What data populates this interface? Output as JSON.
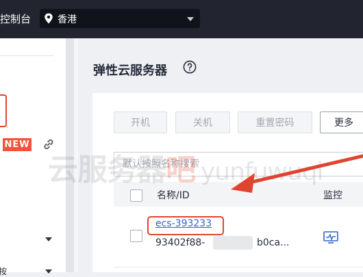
{
  "topbar": {
    "console_label": "控制台",
    "region": "香港"
  },
  "sidebar": {
    "new_badge": "NEW",
    "bottom_hint": "按"
  },
  "page": {
    "title": "弹性云服务器"
  },
  "toolbar": {
    "start_label": "开机",
    "stop_label": "关机",
    "reset_label": "重置密码",
    "more_label": "更多"
  },
  "search": {
    "placeholder": "默认按照名称搜索"
  },
  "table": {
    "headers": {
      "name_id": "名称/ID",
      "monitor": "监控"
    },
    "rows": [
      {
        "name": "ecs-393233",
        "id_prefix": "93402f88-",
        "id_suffix": "b0ca..."
      }
    ]
  },
  "watermark": {
    "part1": "云服务器",
    "part2": "吧",
    "pinyin": "yunfuwuqi"
  },
  "colors": {
    "topbar": "#222530",
    "accent_red": "#e0442f",
    "link_blue": "#2e63c8"
  }
}
